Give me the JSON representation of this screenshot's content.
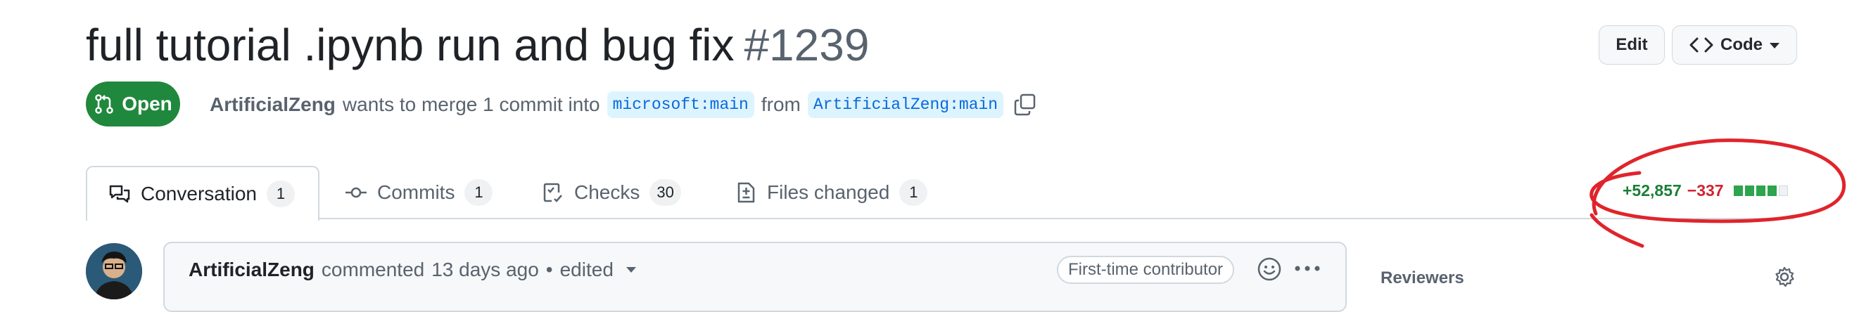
{
  "pr": {
    "title": "full tutorial .ipynb run and bug fix",
    "number": "#1239",
    "state": "Open",
    "author": "ArtificialZeng",
    "merge_text": "wants to merge 1 commit into",
    "base_branch": "microsoft:main",
    "from_text": "from",
    "head_branch": "ArtificialZeng:main"
  },
  "header_buttons": {
    "edit": "Edit",
    "code": "Code"
  },
  "tabs": [
    {
      "label": "Conversation",
      "count": "1",
      "icon": "comment-discussion-icon"
    },
    {
      "label": "Commits",
      "count": "1",
      "icon": "git-commit-icon"
    },
    {
      "label": "Checks",
      "count": "30",
      "icon": "checklist-icon"
    },
    {
      "label": "Files changed",
      "count": "1",
      "icon": "file-diff-icon"
    }
  ],
  "diffstat": {
    "additions": "+52,857",
    "deletions": "−337",
    "blocks": [
      "green",
      "green",
      "green",
      "green",
      "neutral"
    ]
  },
  "comment": {
    "author": "ArtificialZeng",
    "action": "commented",
    "time": "13 days ago",
    "separator": "•",
    "edited": "edited",
    "badge": "First-time contributor"
  },
  "sidebar": {
    "reviewers_label": "Reviewers"
  },
  "colors": {
    "open_green": "#1f883d",
    "addition_green": "#1a7f37",
    "deletion_red": "#d1242f",
    "branch_blue": "#0969da",
    "annotation_red": "#e0242b"
  }
}
